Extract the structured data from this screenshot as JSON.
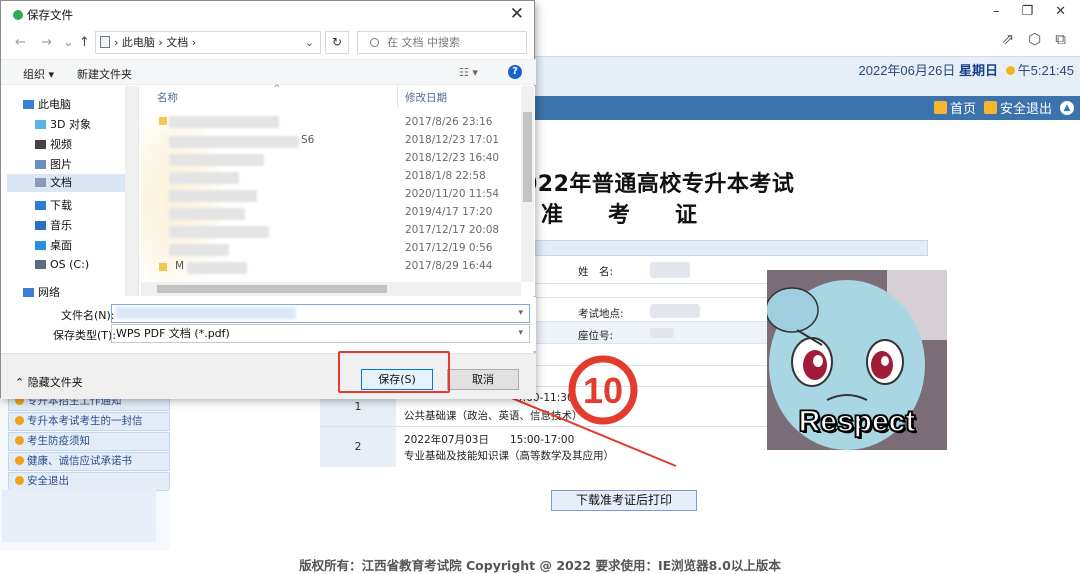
{
  "browser": {
    "win_minimize": "–",
    "win_restore": "❐",
    "win_close": "✕",
    "tool_share": "⇗",
    "tool_ext": "⬡",
    "tool_sidebar": "⧉"
  },
  "site": {
    "date": "2022年06月26日",
    "weekday": "星期日",
    "time": "午5:21:45",
    "nav_home": "首页",
    "nav_logout": "安全退出",
    "nav_up": "▲",
    "sidebar_items": [
      "专升本招生工作通知",
      "专升本考试考生的一封信",
      "考生防疫须知",
      "健康、诚信应试承诺书",
      "安全退出"
    ],
    "exam_title": "022年普通高校专升本考试",
    "exam_subtitle": "准考证",
    "fields": {
      "name_label": "姓　名:",
      "location_label": "考试地点:",
      "seat_label": "座位号:"
    },
    "schedule": [
      {
        "num": "1",
        "line1": "9:00-11:30",
        "line2": "公共基础课（政治、英语、信息技术）"
      },
      {
        "num": "2",
        "line1": "2022年07月03日　　15:00-17:00",
        "line2": "专业基础及技能知识课（高等数学及其应用）"
      }
    ],
    "download_button": "下载准考证后打印",
    "footer": "版权所有：江西省教育考试院 Copyright @ 2022 要求使用：IE浏览器8.0以上版本"
  },
  "meme": {
    "caption": "Respect"
  },
  "annotation": {
    "step_number": "10",
    "color": "#e33b2e"
  },
  "dialog": {
    "title": "保存文件",
    "close": "✕",
    "nav_back": "←",
    "nav_forward": "→",
    "nav_recent": "⌄",
    "nav_up": "↑",
    "address": "› 此电脑 › 文档 ›",
    "address_dropdown": "⌄",
    "refresh": "↻",
    "search_placeholder": "在 文档 中搜索",
    "toolbar": {
      "organize": "组织 ▾",
      "new_folder": "新建文件夹",
      "view": "☷ ▾",
      "help": "?"
    },
    "nav_pane": [
      {
        "label": "此电脑",
        "color": "#3b7fd4"
      },
      {
        "label": "3D 对象",
        "color": "#5bb1e8"
      },
      {
        "label": "视频",
        "color": "#444"
      },
      {
        "label": "图片",
        "color": "#6a8fc0"
      },
      {
        "label": "文档",
        "color": "#8a9bb5"
      },
      {
        "label": "下载",
        "color": "#2d7bd6"
      },
      {
        "label": "音乐",
        "color": "#2d6fc4"
      },
      {
        "label": "桌面",
        "color": "#2a8fe0"
      },
      {
        "label": "OS (C:)",
        "color": "#5a6d86"
      },
      {
        "label": "网络",
        "color": "#3b7fd4"
      }
    ],
    "columns": {
      "name": "名称",
      "date": "修改日期"
    },
    "file_dates": [
      "2017/8/26 23:16",
      "2018/12/23 17:01",
      "2018/12/23 16:40",
      "2018/1/8 22:58",
      "2020/11/20 11:54",
      "2019/4/17 17:20",
      "2017/12/17 20:08",
      "2017/12/19 0:56",
      "2017/8/29 16:44"
    ],
    "file_suffix_s6": "S6",
    "file_suffix_m": "M",
    "filename_label": "文件名(N):",
    "filetype_label": "保存类型(T):",
    "filetype_value": "WPS PDF 文档 (*.pdf)",
    "hide_folders": "隐藏文件夹",
    "save_button": "保存(S)",
    "cancel_button": "取消"
  }
}
